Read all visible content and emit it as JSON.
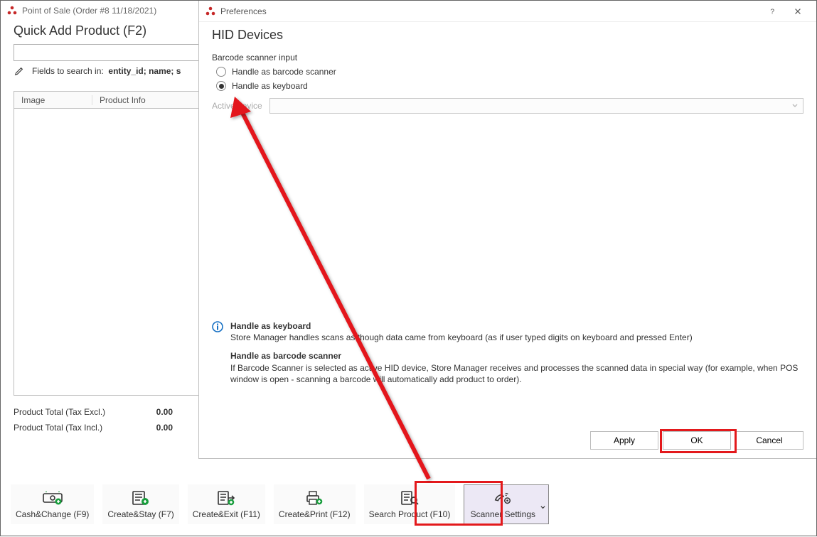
{
  "pos": {
    "title": "Point of Sale (Order #8 11/18/2021)",
    "heading": "Quick Add Product (F2)",
    "fields_label": "Fields to search in:",
    "fields_value": "entity_id; name; s",
    "columns": {
      "image": "Image",
      "info": "Product Info"
    },
    "totals": {
      "excl_label": "Product Total (Tax Excl.)",
      "incl_label": "Product Total (Tax Incl.)",
      "excl_value": "0.00",
      "incl_value": "0.00"
    }
  },
  "toolbar": {
    "cash_change": "Cash&Change (F9)",
    "create_stay": "Create&Stay (F7)",
    "create_exit": "Create&Exit (F11)",
    "create_print": "Create&Print (F12)",
    "search_product": "Search Product (F10)",
    "scanner_settings": "Scanner Settings"
  },
  "prefs": {
    "title": "Preferences",
    "heading": "HID Devices",
    "group_label": "Barcode scanner input",
    "radio_scanner": "Handle as barcode scanner",
    "radio_keyboard": "Handle as keyboard",
    "active_device_label": "Active device",
    "info": {
      "kb_title": "Handle as keyboard",
      "kb_text": "Store Manager handles scans as though data came from keyboard (as if user typed digits on keyboard and pressed Enter)",
      "sc_title": "Handle as barcode scanner",
      "sc_text": "If Barcode Scanner is selected as active HID device, Store Manager receives and processes the scanned data in special way (for example, when POS window is open - scanning a barcode will automatically add product to order)."
    },
    "buttons": {
      "apply": "Apply",
      "ok": "OK",
      "cancel": "Cancel"
    }
  }
}
